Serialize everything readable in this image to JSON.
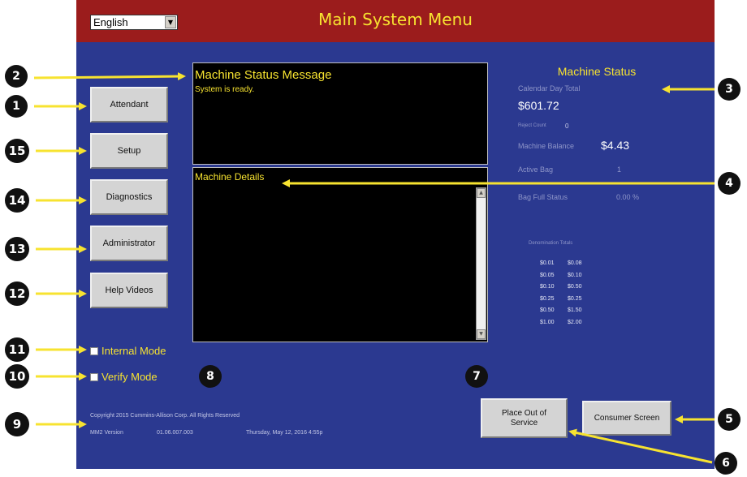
{
  "header": {
    "title": "Main System Menu",
    "language": "English"
  },
  "menu": [
    {
      "label": "Attendant"
    },
    {
      "label": "Setup"
    },
    {
      "label": "Diagnostics"
    },
    {
      "label": "Administrator"
    },
    {
      "label": "Help Videos"
    }
  ],
  "status_panel": {
    "title": "Machine Status Message",
    "message": "System is ready."
  },
  "details_panel": {
    "title": "Machine Details"
  },
  "machine_status": {
    "title": "Machine Status",
    "calendar_day_total_label": "Calendar Day Total",
    "calendar_day_total_value": "$601.72",
    "reject_count_label": "Reject Count",
    "reject_count_value": "0",
    "machine_balance_label": "Machine Balance",
    "machine_balance_value": "$4.43",
    "active_bag_label": "Active Bag",
    "active_bag_value": "1",
    "bag_full_label": "Bag Full Status",
    "bag_full_value": "0.00 %",
    "denomination_totals_label": "Denomination Totals",
    "denominations": [
      {
        "denom": "$0.01",
        "total": "$0.08"
      },
      {
        "denom": "$0.05",
        "total": "$0.10"
      },
      {
        "denom": "$0.10",
        "total": "$0.50"
      },
      {
        "denom": "$0.25",
        "total": "$0.25"
      },
      {
        "denom": "$0.50",
        "total": "$1.50"
      },
      {
        "denom": "$1.00",
        "total": "$2.00"
      }
    ]
  },
  "modes": {
    "internal": "Internal Mode",
    "verify": "Verify Mode"
  },
  "footer": {
    "copyright": "Copyright 2015 Cummins-Allison Corp. All Rights Reserved",
    "version_label": "MM2 Version",
    "version_value": "01.06.007.003",
    "datetime": "Thursday, May 12, 2016 4:55p"
  },
  "buttons": {
    "place_out_of_service": "Place Out of Service",
    "consumer_screen": "Consumer Screen"
  },
  "callouts": {
    "c1": "1",
    "c2": "2",
    "c3": "3",
    "c4": "4",
    "c5": "5",
    "c6": "6",
    "c7": "7",
    "c8": "8",
    "c9": "9",
    "c10": "10",
    "c11": "11",
    "c12": "12",
    "c13": "13",
    "c14": "14",
    "c15": "15"
  },
  "colors": {
    "screen_bg": "#2b3990",
    "title_bar": "#9b1c1c",
    "accent_yellow": "#f7e330",
    "callout_bg": "#111111"
  }
}
